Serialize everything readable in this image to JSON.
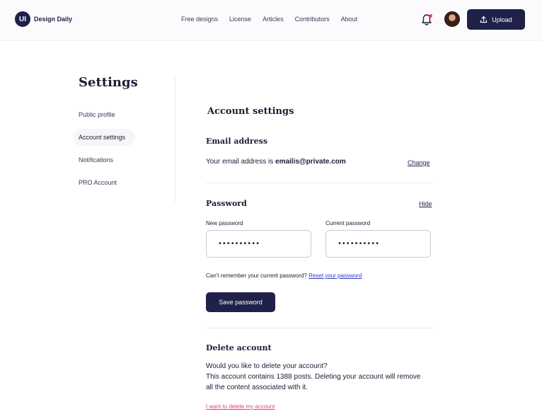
{
  "header": {
    "logo_badge": "UI",
    "logo_text": "Design Daily",
    "nav": [
      "Free designs",
      "License",
      "Articles",
      "Contributors",
      "About"
    ],
    "upload_label": "Upload"
  },
  "sidebar": {
    "title": "Settings",
    "items": [
      {
        "label": "Public profile"
      },
      {
        "label": "Account settings"
      },
      {
        "label": "Notifications"
      },
      {
        "label": "PRO Account"
      }
    ]
  },
  "main": {
    "title": "Account settings",
    "email": {
      "heading": "Email address",
      "prefix": "Your email address is ",
      "address": "emailis@private.com",
      "change_label": "Change"
    },
    "password": {
      "heading": "Password",
      "hide_label": "Hide",
      "new_label": "New password",
      "new_value": "••••••••••",
      "current_label": "Current password",
      "current_value": "••••••••••",
      "hint": "Can't remember your current password? ",
      "reset_label": "Reset your password",
      "save_label": "Save password"
    },
    "delete": {
      "heading": "Delete account",
      "line1": "Would you like to delete your account?",
      "line2": "This account contains 1388 posts. Deleting your account will remove all the content associated with it.",
      "link_label": "I want to delete my account"
    }
  },
  "colors": {
    "primary": "#1f2149",
    "danger_link": "#e83d8a",
    "notification_dot": "#ef3e6b",
    "link_blue": "#2f3cc4"
  },
  "icons": [
    "bell-icon",
    "upload-icon",
    "avatar"
  ]
}
